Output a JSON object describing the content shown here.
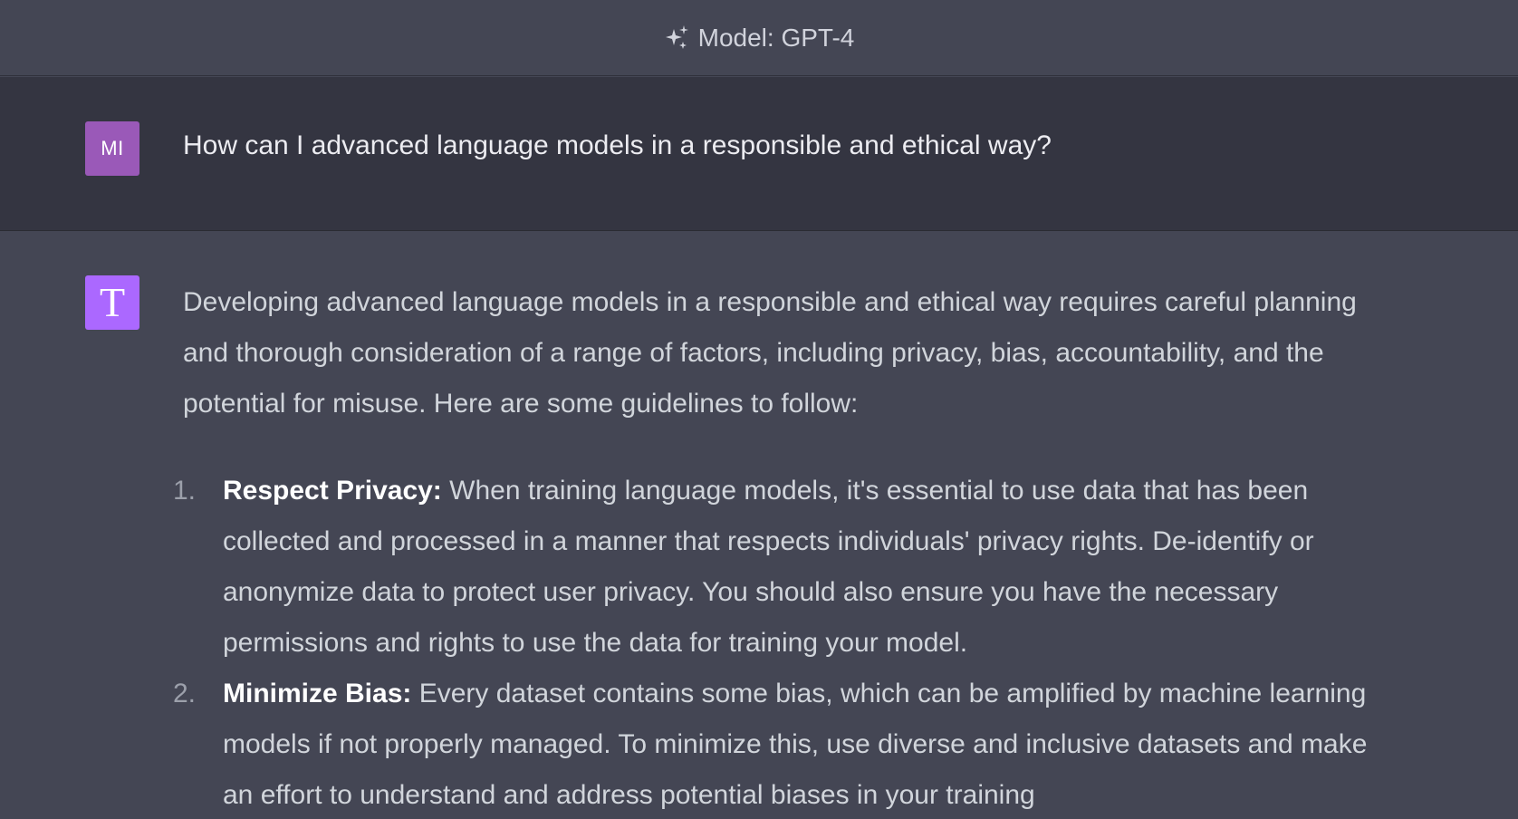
{
  "header": {
    "model_label": "Model: GPT-4",
    "icon": "sparkle-icon"
  },
  "user_message": {
    "avatar_initials": "MI",
    "avatar_color": "#9a59b8",
    "text": "How can I advanced language models in a responsible and ethical way?"
  },
  "assistant_message": {
    "avatar_letter": "T",
    "avatar_color": "#ab68ff",
    "intro": "Developing advanced language models in a responsible and ethical way requires careful planning and thorough consideration of a range of factors, including privacy, bias, accountability, and the potential for misuse. Here are some guidelines to follow:",
    "items": [
      {
        "number": "1.",
        "title": "Respect Privacy:",
        "body": "When training language models, it's essential to use data that has been collected and processed in a manner that respects individuals' privacy rights. De-identify or anonymize data to protect user privacy. You should also ensure you have the necessary permissions and rights to use the data for training your model."
      },
      {
        "number": "2.",
        "title": "Minimize Bias:",
        "body": "Every dataset contains some bias, which can be amplified by machine learning models if not properly managed. To minimize this, use diverse and inclusive datasets and make an effort to understand and address potential biases in your training"
      }
    ]
  },
  "colors": {
    "page_background": "#444654",
    "user_row_background": "#343541",
    "text_primary": "#ececf1",
    "text_secondary": "#d1d5db"
  }
}
